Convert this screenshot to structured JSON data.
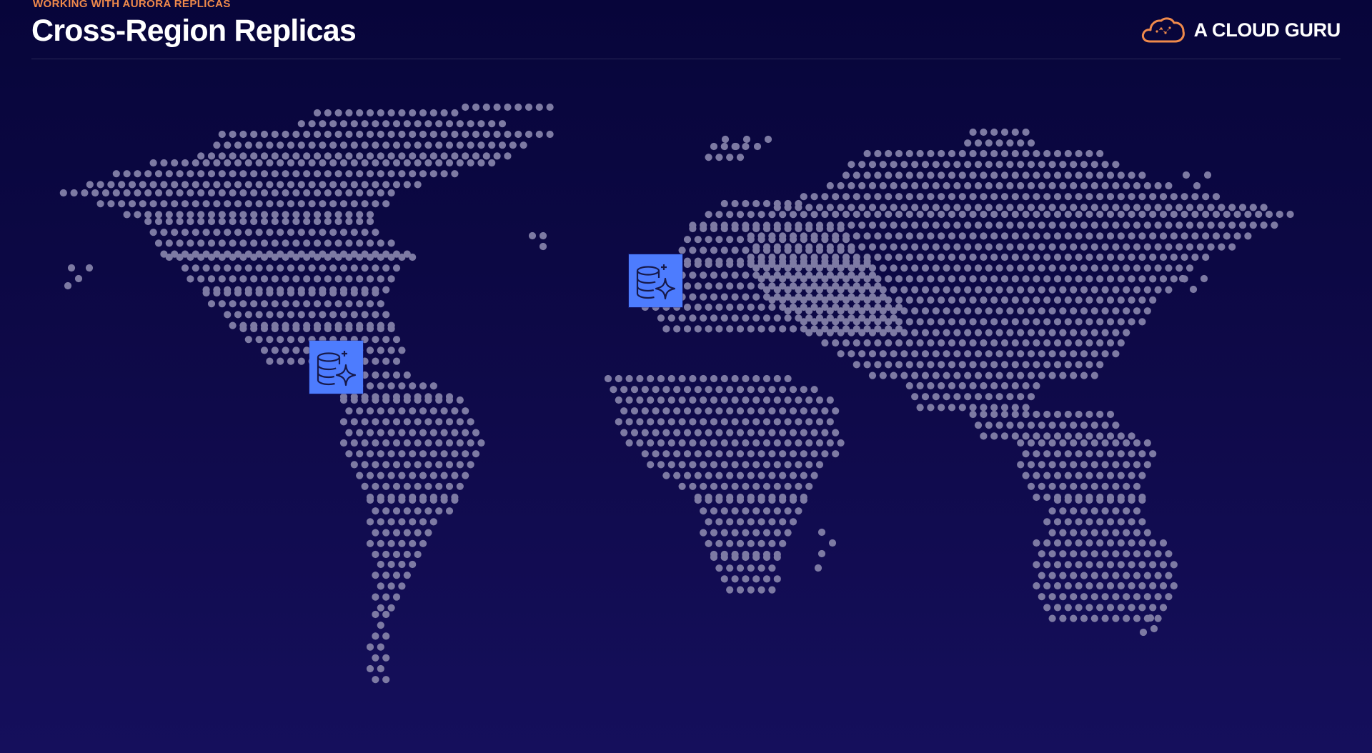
{
  "header": {
    "eyebrow": "WORKING WITH AURORA REPLICAS",
    "title": "Cross-Region Replicas",
    "brand": {
      "name": "A CLOUD GURU",
      "logo_icon": "cloud-logo-icon",
      "logo_color": "#f08a4b"
    }
  },
  "map": {
    "style": "dotted world map",
    "dot_color": "#7d7aa3"
  },
  "replicas": [
    {
      "region": "North America",
      "icon": "aurora-database-icon",
      "color": "#4d7cfe"
    },
    {
      "region": "Europe",
      "icon": "aurora-database-icon",
      "color": "#4d7cfe"
    }
  ],
  "colors": {
    "background_top": "#07053a",
    "background_bottom": "#150f5c",
    "accent": "#f08a4b"
  }
}
